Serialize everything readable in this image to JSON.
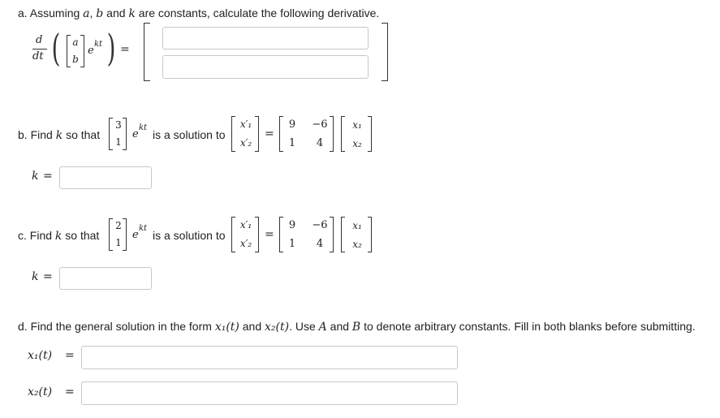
{
  "part_a": {
    "label": "a. Assuming ",
    "var_a": "a",
    "comma1": ", ",
    "var_b": "b",
    "and": " and ",
    "var_k": "k",
    "rest": " are constants, calculate the following derivative.",
    "frac_num": "d",
    "frac_den": "dt",
    "vec": [
      "a",
      "b"
    ],
    "exp_base": "e",
    "exp_pow": "kt",
    "eq": "=",
    "answer_top": "",
    "answer_bottom": ""
  },
  "part_b": {
    "label": "b. Find ",
    "var_k": "k",
    "so_that": " so that",
    "vec": [
      "3",
      "1"
    ],
    "exp_base": "e",
    "exp_pow": "kt",
    "is_solution": "is a solution to",
    "lhs": [
      "x′₁",
      "x′₂"
    ],
    "eq": "=",
    "matrix": [
      [
        "9",
        "−6"
      ],
      [
        "1",
        "4"
      ]
    ],
    "rhs": [
      "x₁",
      "x₂"
    ],
    "k_label": "k",
    "k_eq": "=",
    "k_value": ""
  },
  "part_c": {
    "label": "c. Find ",
    "var_k": "k",
    "so_that": " so that",
    "vec": [
      "2",
      "1"
    ],
    "exp_base": "e",
    "exp_pow": "kt",
    "is_solution": "is a solution to",
    "lhs": [
      "x′₁",
      "x′₂"
    ],
    "eq": "=",
    "matrix": [
      [
        "9",
        "−6"
      ],
      [
        "1",
        "4"
      ]
    ],
    "rhs": [
      "x₁",
      "x₂"
    ],
    "k_label": "k",
    "k_eq": "=",
    "k_value": ""
  },
  "part_d": {
    "text_1": "d. Find the general solution in the form ",
    "x1t": "x₁(t)",
    "and": " and ",
    "x2t": "x₂(t)",
    "text_2": ". Use ",
    "var_A": "A",
    "and2": " and ",
    "var_B": "B",
    "text_3": " to denote arbitrary constants. Fill in both blanks before submitting.",
    "x1_label": "x₁(t)",
    "x1_eq": "=",
    "x1_value": "",
    "x2_label": "x₂(t)",
    "x2_eq": "=",
    "x2_value": ""
  }
}
